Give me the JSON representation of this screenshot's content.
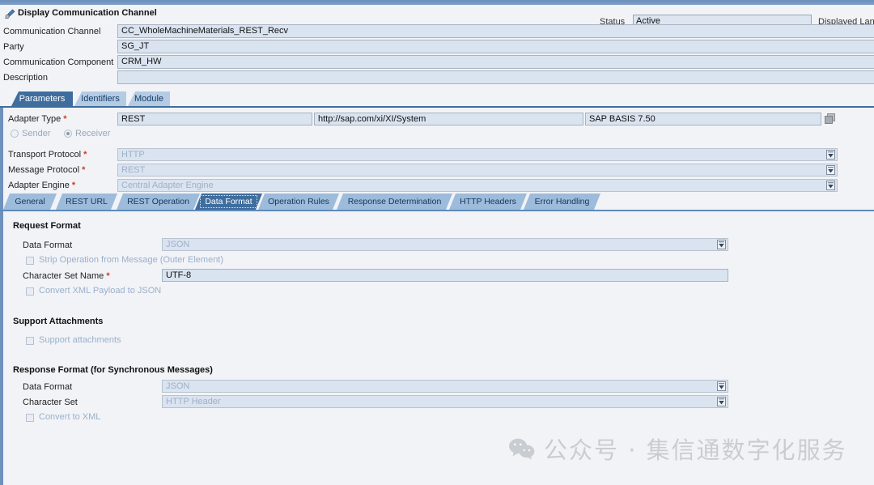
{
  "window": {
    "title": "Display Communication Channel",
    "title_icon": "pen-magnifier-icon"
  },
  "header": {
    "status_label": "Status",
    "status_value": "Active",
    "displayed_language_label": "Displayed Lan",
    "fields": [
      {
        "label": "Communication Channel",
        "value": "CC_WholeMachineMaterials_REST_Recv"
      },
      {
        "label": "Party",
        "value": "SG_JT"
      },
      {
        "label": "Communication Component",
        "value": "CRM_HW"
      },
      {
        "label": "Description",
        "value": ""
      }
    ]
  },
  "main_tabs": [
    {
      "label": "Parameters",
      "selected": true
    },
    {
      "label": "Identifiers",
      "selected": false
    },
    {
      "label": "Module",
      "selected": false
    }
  ],
  "parameters": {
    "adapter_type": {
      "label": "Adapter Type",
      "required": true,
      "value": "REST",
      "namespace": "http://sap.com/xi/XI/System",
      "software_component": "SAP BASIS 7.50",
      "copy_icon": "copy-icon"
    },
    "direction": {
      "sender_label": "Sender",
      "receiver_label": "Receiver",
      "selected": "Receiver"
    },
    "rows": [
      {
        "label": "Transport Protocol",
        "required": true,
        "value": "HTTP",
        "disabled": true,
        "dropdown": true
      },
      {
        "label": "Message Protocol",
        "required": true,
        "value": "REST",
        "disabled": true,
        "dropdown": true
      },
      {
        "label": "Adapter Engine",
        "required": true,
        "value": "Central Adapter Engine",
        "disabled": true,
        "dropdown": true
      }
    ]
  },
  "sub_tabs": [
    {
      "label": "General",
      "selected": false
    },
    {
      "label": "REST URL",
      "selected": false
    },
    {
      "label": "REST Operation",
      "selected": false
    },
    {
      "label": "Data Format",
      "selected": true
    },
    {
      "label": "Operation Rules",
      "selected": false
    },
    {
      "label": "Response Determination",
      "selected": false
    },
    {
      "label": "HTTP Headers",
      "selected": false
    },
    {
      "label": "Error Handling",
      "selected": false
    }
  ],
  "data_format": {
    "request_section_title": "Request Format",
    "request_data_format_label": "Data Format",
    "request_data_format_value": "JSON",
    "strip_operation_label": "Strip Operation from Message (Outer Element)",
    "strip_operation_checked": false,
    "charset_name_label": "Character Set Name",
    "charset_name_required": true,
    "charset_name_value": "UTF-8",
    "convert_xml_to_json_label": "Convert XML Payload to JSON",
    "convert_xml_to_json_checked": false,
    "attachments_section_title": "Support Attachments",
    "support_attachments_label": "Support attachments",
    "support_attachments_checked": false,
    "response_section_title": "Response Format (for Synchronous Messages)",
    "response_data_format_label": "Data Format",
    "response_data_format_value": "JSON",
    "response_charset_label": "Character Set",
    "response_charset_value": "HTTP Header",
    "convert_to_xml_label": "Convert to XML",
    "convert_to_xml_checked": false
  },
  "watermark": {
    "icon": "wechat-icon",
    "text": "公众号 · 集信通数字化服务"
  },
  "colors": {
    "accent_blue": "#3e6d9e",
    "rail_blue": "#6e91bd",
    "field_bg": "#dae3f0",
    "page_bg": "#f1f3f7",
    "required_red": "#d13a1f",
    "disabled_text": "#9fb0c6"
  }
}
